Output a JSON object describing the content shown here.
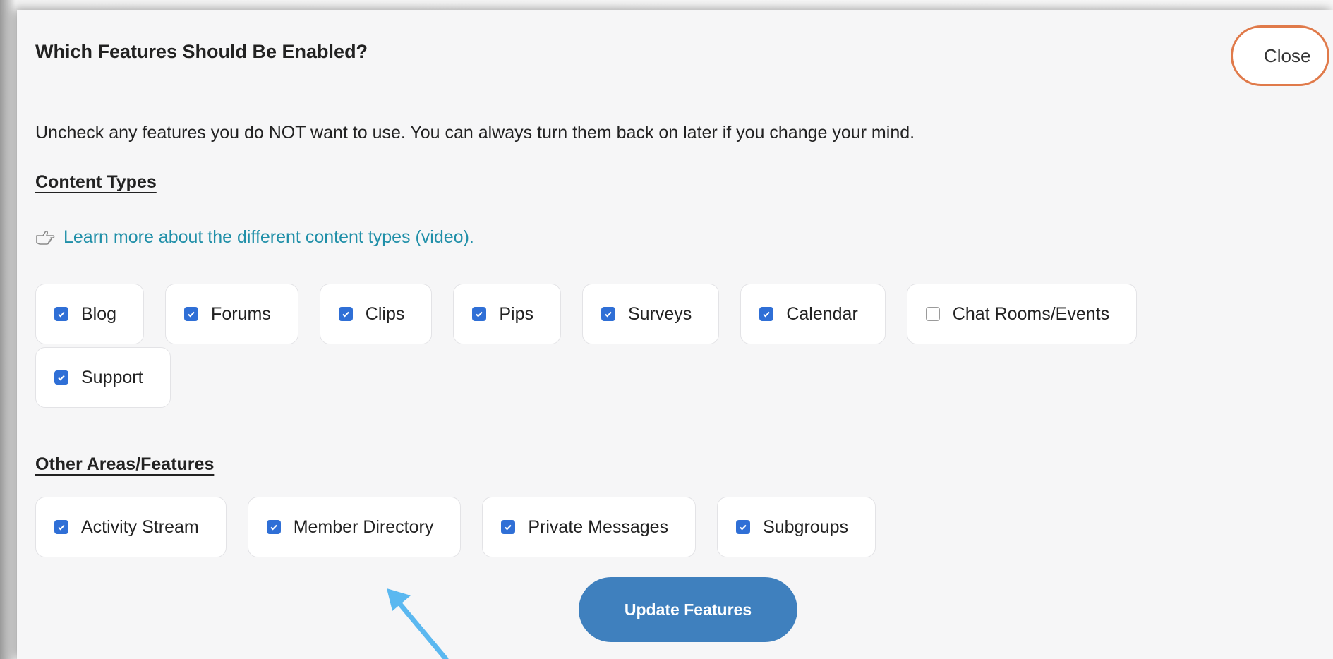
{
  "modal": {
    "title": "Which Features Should Be Enabled?",
    "close_label": "Close",
    "intro": "Uncheck any features you do NOT want to use. You can always turn them back on later if you change your mind."
  },
  "content_types": {
    "heading": "Content Types",
    "learn_more_icon": "pointing-hand-icon",
    "learn_more_link": "Learn more about the different content types (video).",
    "items": [
      {
        "label": "Blog",
        "checked": true
      },
      {
        "label": "Forums",
        "checked": true
      },
      {
        "label": "Clips",
        "checked": true
      },
      {
        "label": "Pips",
        "checked": true
      },
      {
        "label": "Surveys",
        "checked": true
      },
      {
        "label": "Calendar",
        "checked": true
      },
      {
        "label": "Chat Rooms/Events",
        "checked": false
      },
      {
        "label": "Support",
        "checked": true
      }
    ]
  },
  "other_features": {
    "heading": "Other Areas/Features",
    "items": [
      {
        "label": "Activity Stream",
        "checked": true
      },
      {
        "label": "Member Directory",
        "checked": true
      },
      {
        "label": "Private Messages",
        "checked": true
      },
      {
        "label": "Subgroups",
        "checked": true
      }
    ]
  },
  "update_label": "Update Features",
  "colors": {
    "checkbox": "#2f6fd6",
    "link": "#1f8fa8",
    "close_border": "#e07a4a",
    "update_button": "#3f80be",
    "annotation_arrow": "#5bb8f0"
  }
}
